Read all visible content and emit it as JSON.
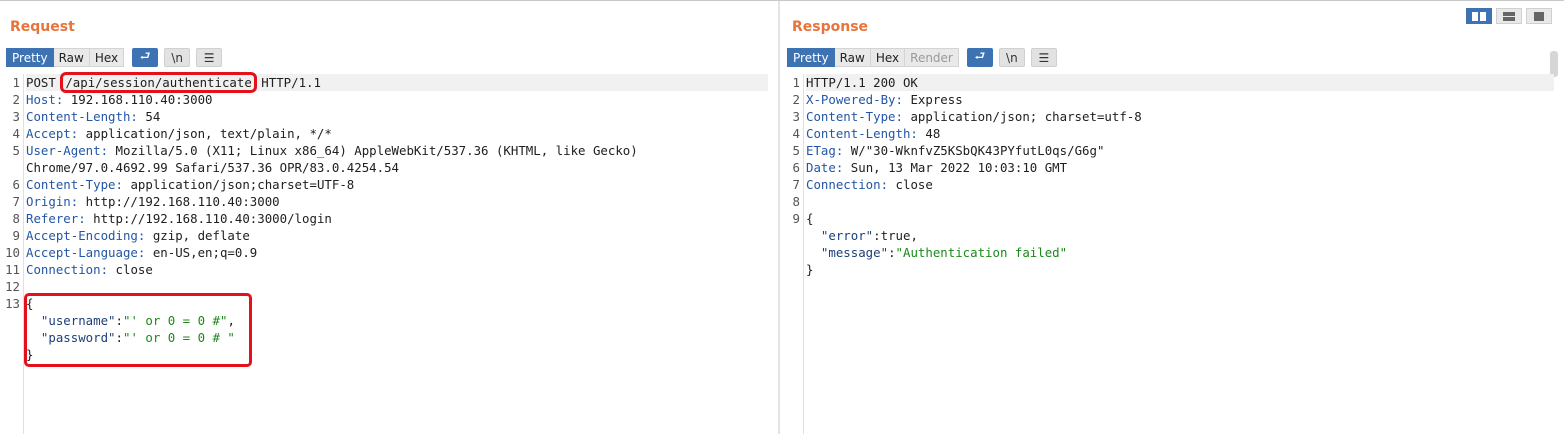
{
  "request": {
    "title": "Request",
    "tabs": [
      "Pretty",
      "Raw",
      "Hex"
    ],
    "icons": [
      "wrap-lines-icon",
      "newline-toggle-icon",
      "menu-icon"
    ],
    "lines": [
      {
        "n": "1",
        "method": "POST",
        "path": "/api/session/authenticate",
        "proto": "HTTP/1.1"
      },
      {
        "n": "2",
        "name": "Host:",
        "value": " 192.168.110.40:3000"
      },
      {
        "n": "3",
        "name": "Content-Length:",
        "value": " 54"
      },
      {
        "n": "4",
        "name": "Accept:",
        "value": " application/json, text/plain, */*"
      },
      {
        "n": "5",
        "name": "User-Agent:",
        "value": " Mozilla/5.0 (X11; Linux x86_64) AppleWebKit/537.36 (KHTML, like Gecko)"
      },
      {
        "n": "",
        "cont": "Chrome/97.0.4692.99 Safari/537.36 OPR/83.0.4254.54"
      },
      {
        "n": "6",
        "name": "Content-Type:",
        "value": " application/json;charset=UTF-8"
      },
      {
        "n": "7",
        "name": "Origin:",
        "value": " http://192.168.110.40:3000"
      },
      {
        "n": "8",
        "name": "Referer:",
        "value": " http://192.168.110.40:3000/login"
      },
      {
        "n": "9",
        "name": "Accept-Encoding:",
        "value": " gzip, deflate"
      },
      {
        "n": "10",
        "name": "Accept-Language:",
        "value": " en-US,en;q=0.9"
      },
      {
        "n": "11",
        "name": "Connection:",
        "value": " close"
      },
      {
        "n": "12",
        "plain": ""
      },
      {
        "n": "13",
        "plain": "{"
      },
      {
        "n": "",
        "indent": "  ",
        "key": "\"username\"",
        "colon": ":",
        "str": "\"' or 0 = 0 #\"",
        "tail": ","
      },
      {
        "n": "",
        "indent": "  ",
        "key": "\"password\"",
        "colon": ":",
        "str": "\"' or 0 = 0 # \"",
        "tail": ""
      },
      {
        "n": "",
        "plain": "}"
      }
    ]
  },
  "response": {
    "title": "Response",
    "tabs": [
      "Pretty",
      "Raw",
      "Hex",
      "Render"
    ],
    "icons": [
      "wrap-lines-icon",
      "newline-toggle-icon",
      "menu-icon"
    ],
    "lines": [
      {
        "n": "1",
        "plain": "HTTP/1.1 200 OK"
      },
      {
        "n": "2",
        "name": "X-Powered-By:",
        "value": " Express"
      },
      {
        "n": "3",
        "name": "Content-Type:",
        "value": " application/json; charset=utf-8"
      },
      {
        "n": "4",
        "name": "Content-Length:",
        "value": " 48"
      },
      {
        "n": "5",
        "name": "ETag:",
        "value": " W/\"30-WknfvZ5KSbQK43PYfutL0qs/G6g\""
      },
      {
        "n": "6",
        "name": "Date:",
        "value": " Sun, 13 Mar 2022 10:03:10 GMT"
      },
      {
        "n": "7",
        "name": "Connection:",
        "value": " close"
      },
      {
        "n": "8",
        "plain": ""
      },
      {
        "n": "9",
        "plain": "{"
      },
      {
        "n": "",
        "indent": "  ",
        "key": "\"error\"",
        "colon": ":",
        "val": "true",
        "tail": ","
      },
      {
        "n": "",
        "indent": "  ",
        "key": "\"message\"",
        "colon": ":",
        "str": "\"Authentication failed\"",
        "tail": ""
      },
      {
        "n": "",
        "plain": "}"
      }
    ]
  },
  "toolbar_glyphs": {
    "wrap": "⮐",
    "newline": "\\n",
    "menu": "☰"
  },
  "view_buttons": [
    "split-view-icon",
    "stacked-view-icon",
    "single-view-icon"
  ],
  "colors": {
    "accent": "#e8743b",
    "active_tab": "#3d73b3",
    "highlight": "#e4111b"
  }
}
